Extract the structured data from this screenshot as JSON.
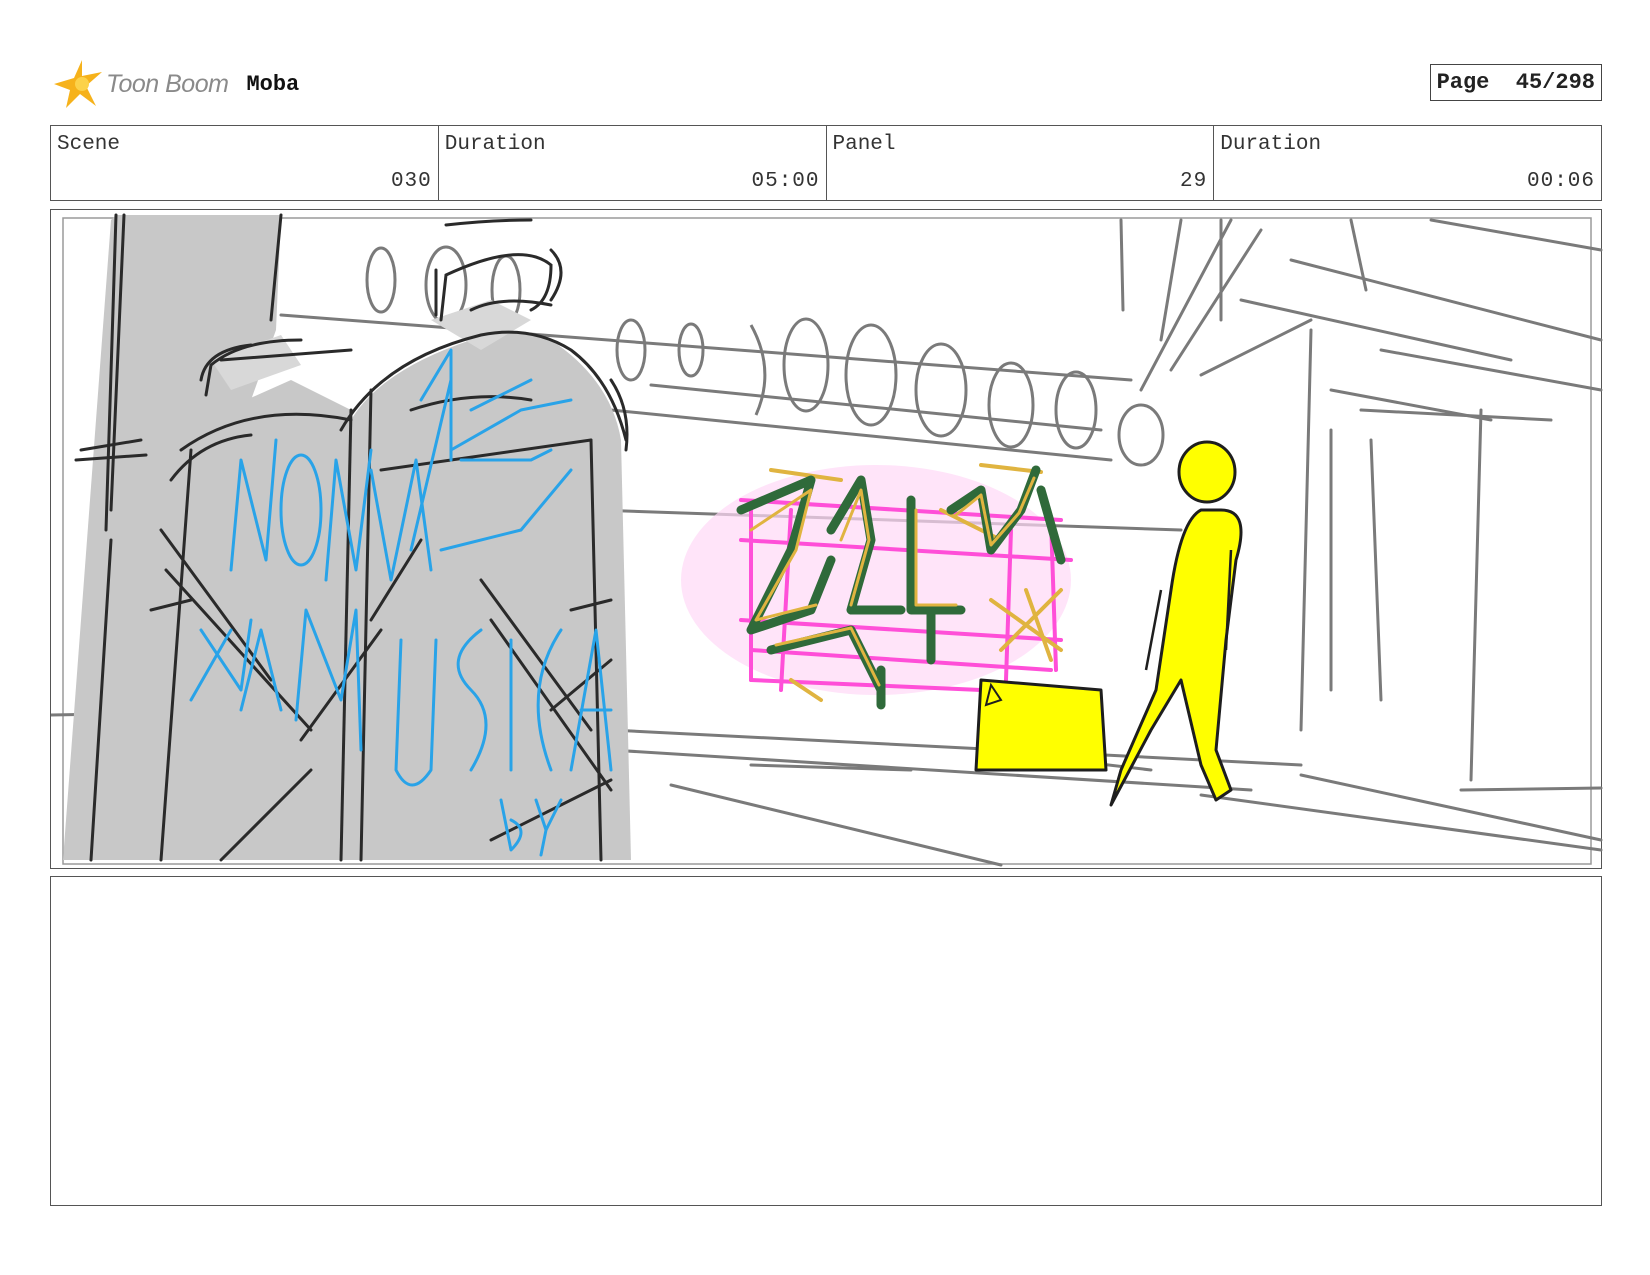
{
  "header": {
    "logo_text": "Toon Boom",
    "project": "Moba",
    "page_label": "Page",
    "page_value": "45/298"
  },
  "meta": {
    "scene_label": "Scene",
    "scene_value": "030",
    "scene_duration_label": "Duration",
    "scene_duration_value": "05:00",
    "panel_label": "Panel",
    "panel_value": "29",
    "panel_duration_label": "Duration",
    "panel_duration_value": "00:06"
  },
  "colors": {
    "sketch_line": "#2a2a2a",
    "sketch_gray": "#7a7a7a",
    "fill_gray": "#c8c8c8",
    "graffiti_blue": "#29a3e8",
    "graffiti_green": "#2f6a3a",
    "graffiti_gold": "#e0b440",
    "graffiti_pink": "#ff4fd8",
    "figure_yellow": "#ffff00",
    "logo_orange": "#f6b21b"
  },
  "icons": {
    "logo": "toon-boom-star-icon"
  }
}
